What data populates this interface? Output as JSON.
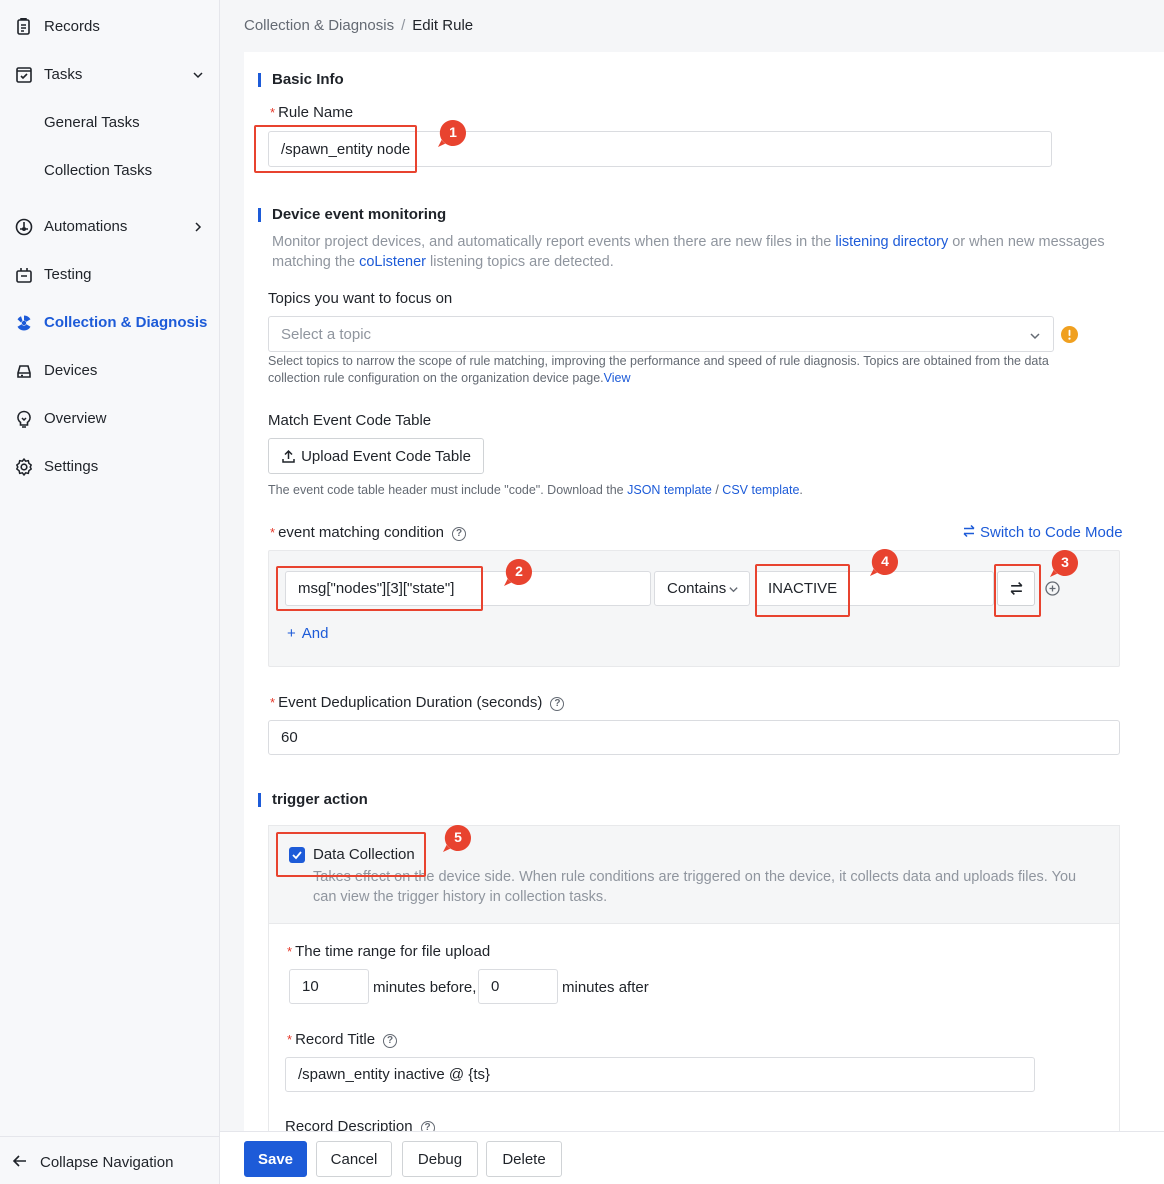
{
  "sidebar": {
    "items": [
      {
        "label": "Records",
        "icon": "records-icon"
      },
      {
        "label": "Tasks",
        "icon": "tasks-icon"
      },
      {
        "label": "General Tasks"
      },
      {
        "label": "Collection Tasks"
      },
      {
        "label": "Automations",
        "icon": "automations-icon"
      },
      {
        "label": "Testing",
        "icon": "testing-icon"
      },
      {
        "label": "Collection & Diagnosis",
        "icon": "diagnosis-icon"
      },
      {
        "label": "Devices",
        "icon": "devices-icon"
      },
      {
        "label": "Overview",
        "icon": "overview-icon"
      },
      {
        "label": "Settings",
        "icon": "settings-icon"
      }
    ],
    "collapse_label": "Collapse Navigation"
  },
  "breadcrumb": {
    "parent": "Collection & Diagnosis",
    "separator": "/",
    "current": "Edit Rule"
  },
  "basic_info": {
    "title": "Basic Info",
    "rule_name_label": "Rule Name",
    "rule_name_value": "/spawn_entity node"
  },
  "monitoring": {
    "title": "Device event monitoring",
    "desc_1": "Monitor project devices, and automatically report events when there are new files in the ",
    "desc_link_1": "listening directory",
    "desc_2": " or when new messages",
    "desc_3": "matching the ",
    "desc_link_2": "coListener",
    "desc_4": " listening topics are detected.",
    "topics_label": "Topics you want to focus on",
    "topics_placeholder": "Select a topic",
    "topics_help_1": "Select topics to narrow the scope of rule matching, improving the performance and speed of rule diagnosis. Topics are obtained from the data",
    "topics_help_2": "collection rule configuration on the organization device page.",
    "topics_help_link": "View",
    "event_code_label": "Match Event Code Table",
    "upload_button": "Upload Event Code Table",
    "event_code_help": "The event code table header must include \"code\". Download the ",
    "json_template": "JSON template",
    "template_sep": " / ",
    "csv_template": "CSV template",
    "template_end": ".",
    "condition_label": "event matching condition",
    "switch_mode": "Switch to Code Mode",
    "condition_field": "msg[\"nodes\"][3][\"state\"]",
    "condition_operator": "Contains",
    "condition_value": "INACTIVE",
    "and_label": "And",
    "dedup_label": "Event Deduplication Duration (seconds)",
    "dedup_value": "60"
  },
  "trigger": {
    "title": "trigger action",
    "data_collection_label": "Data Collection",
    "data_collection_desc_1": "Takes effect on the device side. When rule conditions are triggered on the device, it collects data and uploads files. You",
    "data_collection_desc_2": "can view the trigger history in collection tasks.",
    "time_range_label": "The time range for file upload",
    "minutes_before_value": "10",
    "minutes_before_text": "minutes before,",
    "minutes_after_value": "0",
    "minutes_after_text": "minutes after",
    "record_title_label": "Record Title",
    "record_title_value": "/spawn_entity inactive @ {ts}",
    "record_desc_label": "Record Description"
  },
  "annotations": [
    "1",
    "2",
    "3",
    "4",
    "5"
  ],
  "footer": {
    "save": "Save",
    "cancel": "Cancel",
    "debug": "Debug",
    "delete": "Delete"
  },
  "colors": {
    "accent": "#1d5bd8",
    "annotation": "#e8432f",
    "warning": "#f0a020"
  }
}
